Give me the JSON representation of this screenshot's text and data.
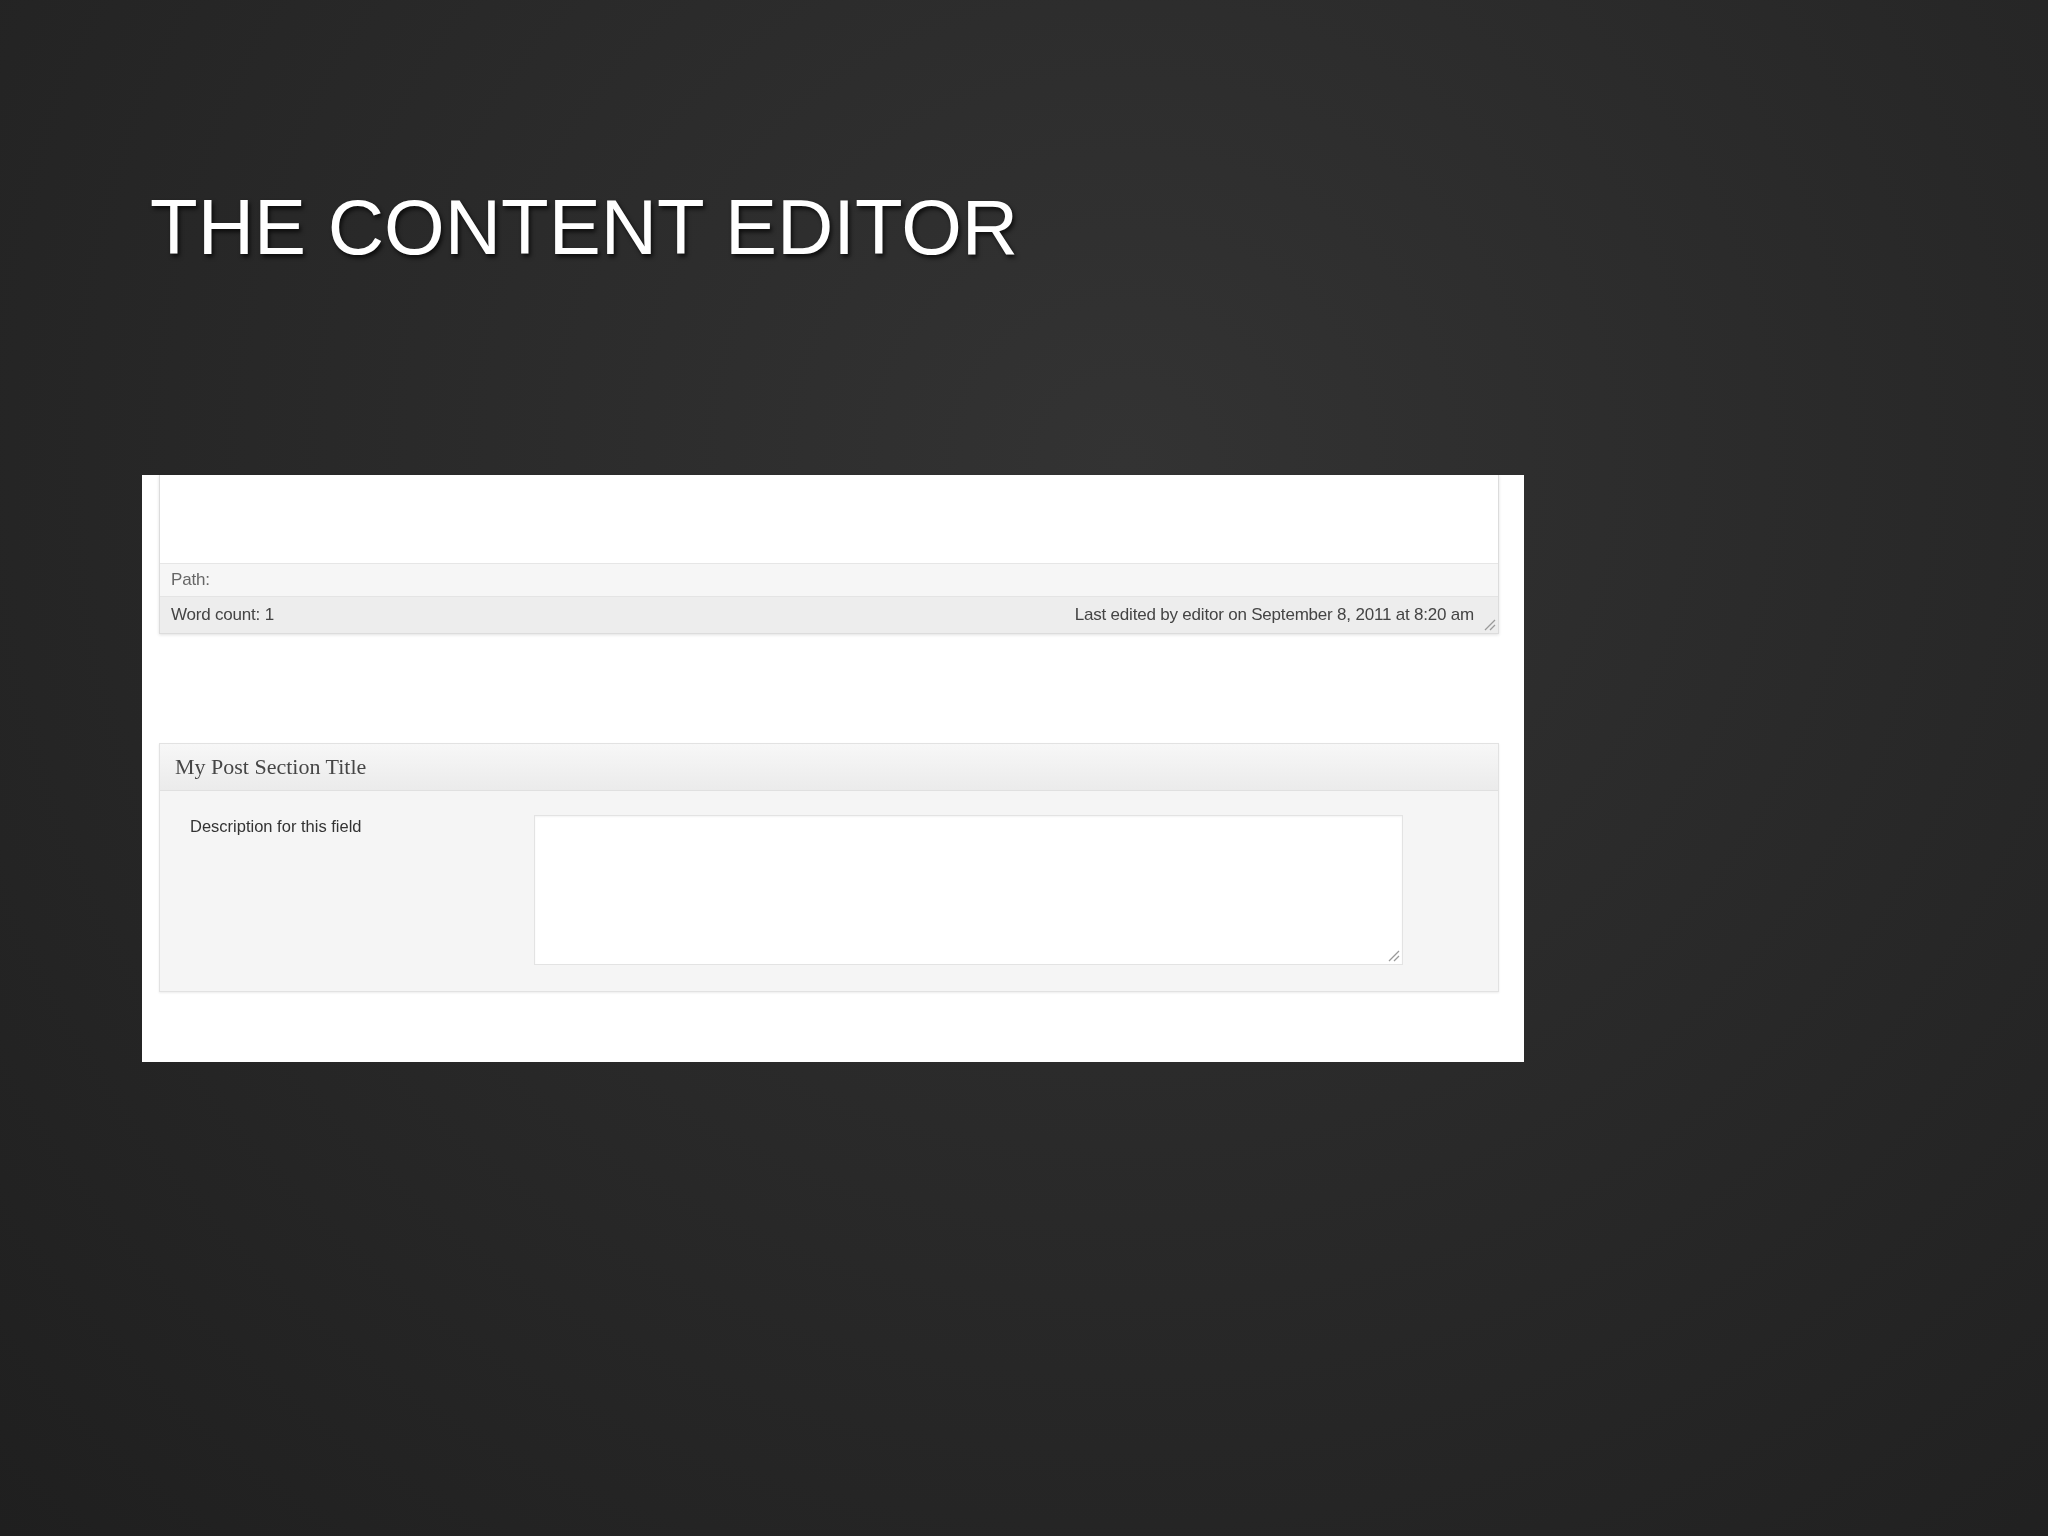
{
  "slide": {
    "title": "THE CONTENT EDITOR"
  },
  "editor": {
    "path_label": "Path:",
    "word_count": "Word count: 1",
    "last_edited": "Last edited by editor on September 8, 2011 at 8:20 am"
  },
  "meta_box": {
    "title": "My Post Section Title",
    "fields": [
      {
        "kind": "textarea",
        "label": "Description for this field"
      }
    ]
  }
}
